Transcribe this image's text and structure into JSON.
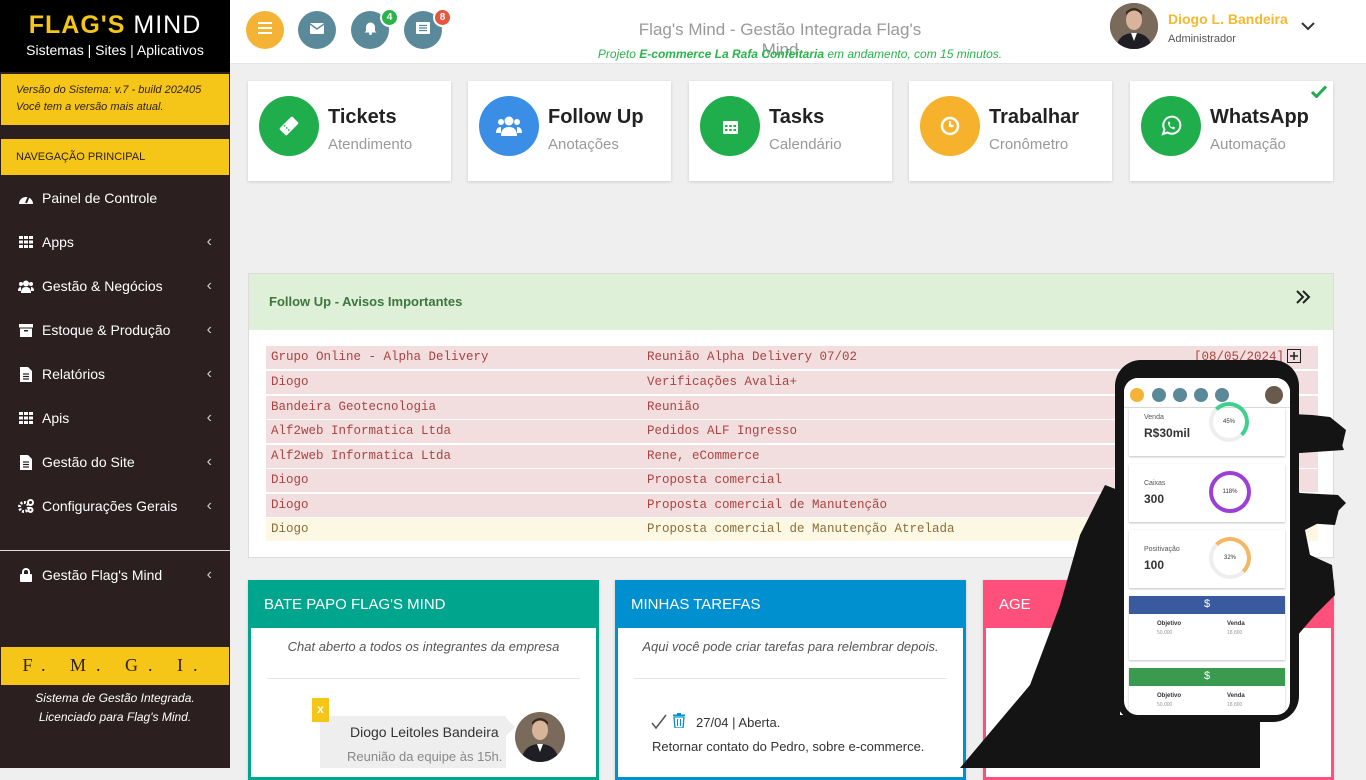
{
  "brand": {
    "logo_a": "FLAG'S",
    "logo_b": " MIND",
    "tagline": "Sistemas | Sites | Aplicativos"
  },
  "version": {
    "line1": "Versão do Sistema: v.7 - build 202405",
    "line2": "Você tem a versão mais atual."
  },
  "nav": {
    "header": "NAVEGAÇÃO PRINCIPAL",
    "items": [
      {
        "label": "Painel de Controle",
        "icon": "dashboard-icon"
      },
      {
        "label": "Apps",
        "icon": "grid-icon"
      },
      {
        "label": "Gestão & Negócios",
        "icon": "users-icon"
      },
      {
        "label": "Estoque & Produção",
        "icon": "box-icon"
      },
      {
        "label": "Relatórios",
        "icon": "file-icon"
      },
      {
        "label": "Apis",
        "icon": "grid-icon"
      },
      {
        "label": "Gestão do Site",
        "icon": "file-icon"
      },
      {
        "label": "Configurações Gerais",
        "icon": "gears-icon"
      }
    ],
    "admin": {
      "label": "Gestão Flag's Mind",
      "icon": "lock-icon"
    }
  },
  "footer": {
    "acronym": "F. M. G. I.",
    "line1": "Sistema de Gestão Integrada.",
    "line2": "Licenciado para Flag's Mind."
  },
  "topbar": {
    "title": "Flag's Mind - Gestão Integrada Flag's Mind",
    "sub_a": "Projeto ",
    "sub_b": "E-commerce La Rafa Confeitaria",
    "sub_c": " em andamento, com 15 minutos.",
    "notif_count": "4",
    "tasks_count": "8"
  },
  "user": {
    "name": "Diogo L. Bandeira",
    "role": "Administrador"
  },
  "cards": [
    {
      "title": "Tickets",
      "sub": "Atendimento",
      "icon": "ticket-icon",
      "color": "#1fae4b"
    },
    {
      "title": "Follow Up",
      "sub": "Anotações",
      "icon": "users-icon",
      "color": "#3a8ee6"
    },
    {
      "title": "Tasks",
      "sub": "Calendário",
      "icon": "calendar-icon",
      "color": "#1fae4b"
    },
    {
      "title": "Trabalhar",
      "sub": "Cronômetro",
      "icon": "clock-icon",
      "color": "#f6b22c"
    },
    {
      "title": "WhatsApp",
      "sub": "Automação",
      "icon": "whatsapp-icon",
      "color": "#1fae4b"
    }
  ],
  "followup": {
    "title": "Follow Up - Avisos Importantes",
    "first_date": "[08/05/2024]",
    "rows": [
      {
        "client": "Grupo Online - Alpha Delivery",
        "subject": "Reunião Alpha Delivery 07/02"
      },
      {
        "client": "Diogo",
        "subject": "Verificações Avalia+"
      },
      {
        "client": "Bandeira Geotecnologia",
        "subject": "Reunião"
      },
      {
        "client": "Alf2web Informatica Ltda",
        "subject": "Pedidos ALF Ingresso"
      },
      {
        "client": "Alf2web Informatica Ltda",
        "subject": "Rene, eCommerce"
      },
      {
        "client": "Diogo",
        "subject": "Proposta comercial"
      },
      {
        "client": "Diogo",
        "subject": "Proposta comercial de Manutenção"
      },
      {
        "client": "Diogo",
        "subject": "Proposta comercial de Manutenção Atrelada"
      }
    ]
  },
  "chat": {
    "title": "BATE PAPO FLAG'S MIND",
    "sub": "Chat aberto a todos os integrantes da empresa",
    "name": "Diogo Leitoles Bandeira",
    "msg": "Reunião da equipe às 15h.",
    "close": "x"
  },
  "tasks": {
    "title": "MINHAS TAREFAS",
    "sub": "Aqui você pode criar tarefas para relembrar depois.",
    "item_date": "27/04 | Aberta.",
    "item_text": "Retornar contato do Pedro, sobre e-commerce."
  },
  "agenda": {
    "title": "AGE"
  },
  "phone": {
    "venda_label": "Venda",
    "venda_value": "R$30mil",
    "venda_pct": "45%",
    "caixas_label": "Caixas",
    "caixas_value": "300",
    "caixas_pct": "118%",
    "pos_label": "Positivação",
    "pos_value": "100",
    "pos_pct": "32%",
    "dollar": "$",
    "obj": "Objetivo",
    "vnd": "Venda",
    "obj_v": "50.000",
    "vnd_v": "18.800"
  },
  "colors": {
    "yellow": "#f5c518",
    "sidebar": "#2b1f1f",
    "green": "#1fae4b",
    "teal": "#00a58e",
    "blue": "#0090d0",
    "pink": "#ff4f7b"
  }
}
